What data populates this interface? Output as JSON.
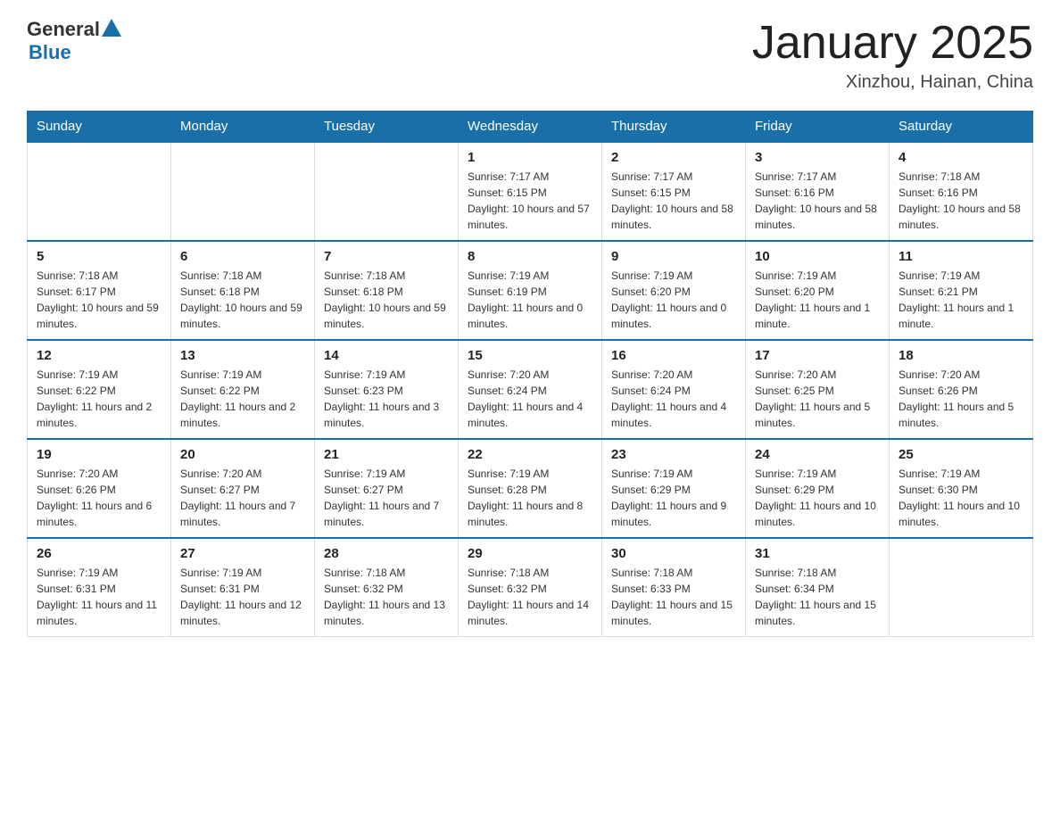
{
  "header": {
    "logo_general": "General",
    "logo_blue": "Blue",
    "title": "January 2025",
    "subtitle": "Xinzhou, Hainan, China"
  },
  "days": [
    "Sunday",
    "Monday",
    "Tuesday",
    "Wednesday",
    "Thursday",
    "Friday",
    "Saturday"
  ],
  "weeks": [
    [
      {
        "day": "",
        "info": ""
      },
      {
        "day": "",
        "info": ""
      },
      {
        "day": "",
        "info": ""
      },
      {
        "day": "1",
        "info": "Sunrise: 7:17 AM\nSunset: 6:15 PM\nDaylight: 10 hours and 57 minutes."
      },
      {
        "day": "2",
        "info": "Sunrise: 7:17 AM\nSunset: 6:15 PM\nDaylight: 10 hours and 58 minutes."
      },
      {
        "day": "3",
        "info": "Sunrise: 7:17 AM\nSunset: 6:16 PM\nDaylight: 10 hours and 58 minutes."
      },
      {
        "day": "4",
        "info": "Sunrise: 7:18 AM\nSunset: 6:16 PM\nDaylight: 10 hours and 58 minutes."
      }
    ],
    [
      {
        "day": "5",
        "info": "Sunrise: 7:18 AM\nSunset: 6:17 PM\nDaylight: 10 hours and 59 minutes."
      },
      {
        "day": "6",
        "info": "Sunrise: 7:18 AM\nSunset: 6:18 PM\nDaylight: 10 hours and 59 minutes."
      },
      {
        "day": "7",
        "info": "Sunrise: 7:18 AM\nSunset: 6:18 PM\nDaylight: 10 hours and 59 minutes."
      },
      {
        "day": "8",
        "info": "Sunrise: 7:19 AM\nSunset: 6:19 PM\nDaylight: 11 hours and 0 minutes."
      },
      {
        "day": "9",
        "info": "Sunrise: 7:19 AM\nSunset: 6:20 PM\nDaylight: 11 hours and 0 minutes."
      },
      {
        "day": "10",
        "info": "Sunrise: 7:19 AM\nSunset: 6:20 PM\nDaylight: 11 hours and 1 minute."
      },
      {
        "day": "11",
        "info": "Sunrise: 7:19 AM\nSunset: 6:21 PM\nDaylight: 11 hours and 1 minute."
      }
    ],
    [
      {
        "day": "12",
        "info": "Sunrise: 7:19 AM\nSunset: 6:22 PM\nDaylight: 11 hours and 2 minutes."
      },
      {
        "day": "13",
        "info": "Sunrise: 7:19 AM\nSunset: 6:22 PM\nDaylight: 11 hours and 2 minutes."
      },
      {
        "day": "14",
        "info": "Sunrise: 7:19 AM\nSunset: 6:23 PM\nDaylight: 11 hours and 3 minutes."
      },
      {
        "day": "15",
        "info": "Sunrise: 7:20 AM\nSunset: 6:24 PM\nDaylight: 11 hours and 4 minutes."
      },
      {
        "day": "16",
        "info": "Sunrise: 7:20 AM\nSunset: 6:24 PM\nDaylight: 11 hours and 4 minutes."
      },
      {
        "day": "17",
        "info": "Sunrise: 7:20 AM\nSunset: 6:25 PM\nDaylight: 11 hours and 5 minutes."
      },
      {
        "day": "18",
        "info": "Sunrise: 7:20 AM\nSunset: 6:26 PM\nDaylight: 11 hours and 5 minutes."
      }
    ],
    [
      {
        "day": "19",
        "info": "Sunrise: 7:20 AM\nSunset: 6:26 PM\nDaylight: 11 hours and 6 minutes."
      },
      {
        "day": "20",
        "info": "Sunrise: 7:20 AM\nSunset: 6:27 PM\nDaylight: 11 hours and 7 minutes."
      },
      {
        "day": "21",
        "info": "Sunrise: 7:19 AM\nSunset: 6:27 PM\nDaylight: 11 hours and 7 minutes."
      },
      {
        "day": "22",
        "info": "Sunrise: 7:19 AM\nSunset: 6:28 PM\nDaylight: 11 hours and 8 minutes."
      },
      {
        "day": "23",
        "info": "Sunrise: 7:19 AM\nSunset: 6:29 PM\nDaylight: 11 hours and 9 minutes."
      },
      {
        "day": "24",
        "info": "Sunrise: 7:19 AM\nSunset: 6:29 PM\nDaylight: 11 hours and 10 minutes."
      },
      {
        "day": "25",
        "info": "Sunrise: 7:19 AM\nSunset: 6:30 PM\nDaylight: 11 hours and 10 minutes."
      }
    ],
    [
      {
        "day": "26",
        "info": "Sunrise: 7:19 AM\nSunset: 6:31 PM\nDaylight: 11 hours and 11 minutes."
      },
      {
        "day": "27",
        "info": "Sunrise: 7:19 AM\nSunset: 6:31 PM\nDaylight: 11 hours and 12 minutes."
      },
      {
        "day": "28",
        "info": "Sunrise: 7:18 AM\nSunset: 6:32 PM\nDaylight: 11 hours and 13 minutes."
      },
      {
        "day": "29",
        "info": "Sunrise: 7:18 AM\nSunset: 6:32 PM\nDaylight: 11 hours and 14 minutes."
      },
      {
        "day": "30",
        "info": "Sunrise: 7:18 AM\nSunset: 6:33 PM\nDaylight: 11 hours and 15 minutes."
      },
      {
        "day": "31",
        "info": "Sunrise: 7:18 AM\nSunset: 6:34 PM\nDaylight: 11 hours and 15 minutes."
      },
      {
        "day": "",
        "info": ""
      }
    ]
  ]
}
